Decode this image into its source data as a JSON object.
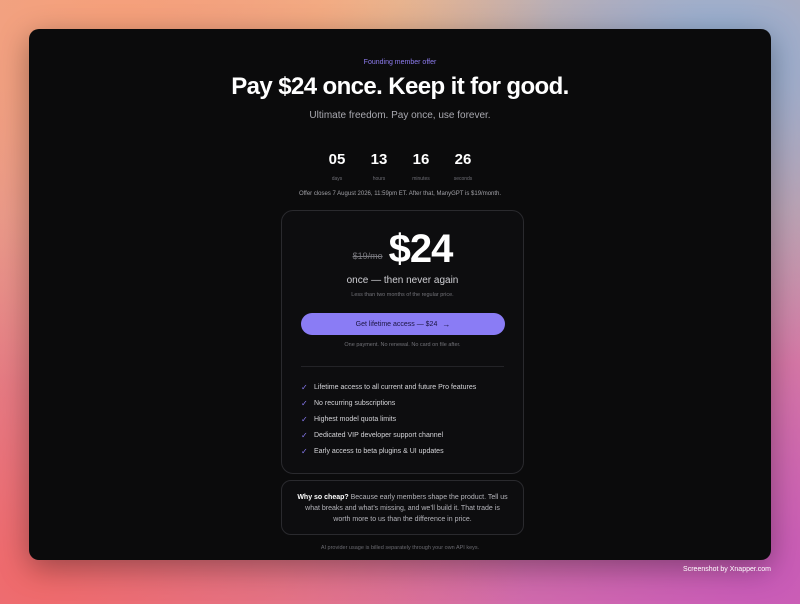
{
  "header": {
    "eyebrow": "Founding member offer",
    "title": "Pay $24 once. Keep it for good.",
    "subtitle": "Ultimate freedom. Pay once, use forever."
  },
  "countdown": {
    "days": {
      "value": "05",
      "label": "days"
    },
    "hours": {
      "value": "13",
      "label": "hours"
    },
    "minutes": {
      "value": "16",
      "label": "minutes"
    },
    "seconds": {
      "value": "26",
      "label": "seconds"
    }
  },
  "offer_note": "Offer closes 7 August 2026, 11:59pm ET. After that, ManyGPT is $19/month.",
  "pricing": {
    "old_price": "$19/mo",
    "price": "$24",
    "once": "once — then never again",
    "note": "Less than two months of the regular price.",
    "cta_label": "Get lifetime access — $24",
    "cta_arrow": "→",
    "cta_note": "One payment. No renewal. No card on file after.",
    "check_icon": "✓",
    "features": [
      "Lifetime access to all current and future Pro features",
      "No recurring subscriptions",
      "Highest model quota limits",
      "Dedicated VIP developer support channel",
      "Early access to beta plugins & UI updates"
    ]
  },
  "why": {
    "heading": "Why so cheap?",
    "body": " Because early members shape the product. Tell us what breaks and what’s missing, and we’ll build it. That trade is worth more to us than the difference in price."
  },
  "footer_note": "AI provider usage is billed separately through your own API keys.",
  "watermark": "Screenshot by Xnapper.com",
  "colors": {
    "accent": "#8a7cf5",
    "background": "#0b0b0c"
  }
}
